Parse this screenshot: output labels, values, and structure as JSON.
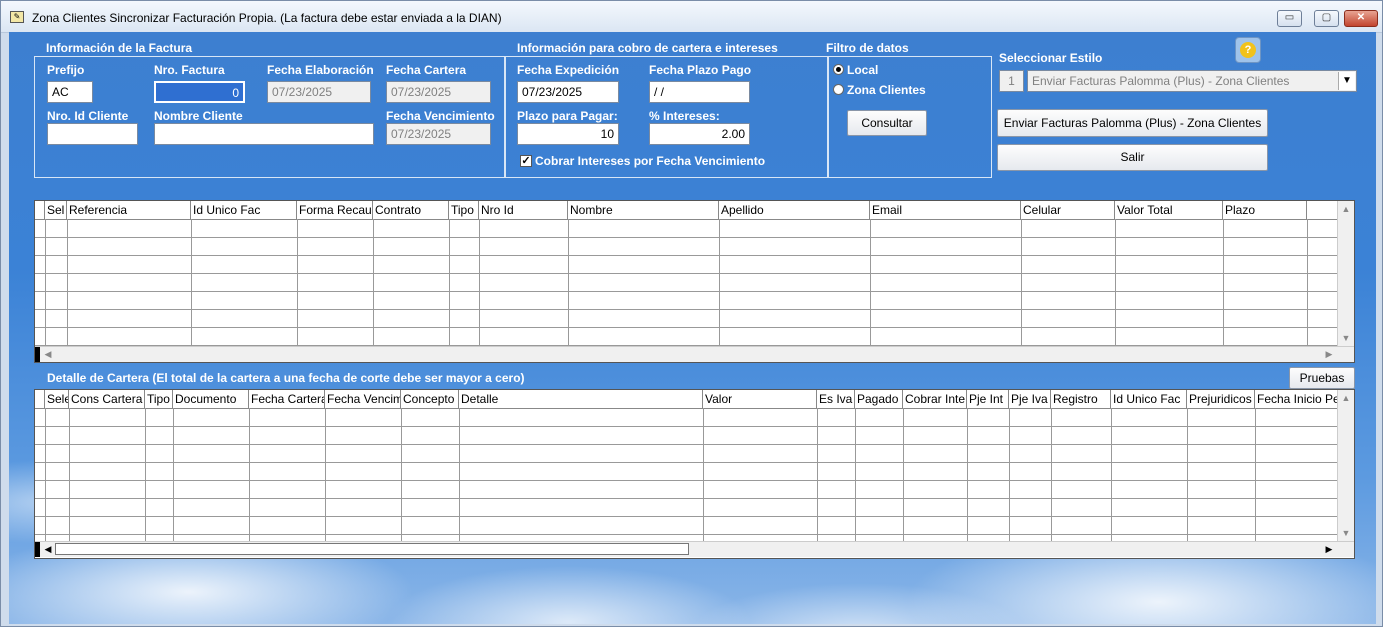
{
  "window": {
    "title": "Zona Clientes Sincronizar Facturación Propia. (La factura debe estar enviada a la DIAN)",
    "minimize_glyph": "▭",
    "maximize_glyph": "▢",
    "close_glyph": "✕"
  },
  "factura": {
    "section_title": "Información de la Factura",
    "prefijo_label": "Prefijo",
    "prefijo_value": "AC",
    "nro_factura_label": "Nro. Factura",
    "nro_factura_value": "0",
    "fecha_elaboracion_label": "Fecha Elaboración",
    "fecha_elaboracion_value": "07/23/2025",
    "fecha_cartera_label": "Fecha Cartera",
    "fecha_cartera_value": "07/23/2025",
    "nro_id_cliente_label": "Nro. Id Cliente",
    "nro_id_cliente_value": "",
    "nombre_cliente_label": "Nombre Cliente",
    "nombre_cliente_value": "",
    "fecha_vencimiento_label": "Fecha Vencimiento",
    "fecha_vencimiento_value": "07/23/2025"
  },
  "cobro": {
    "section_title": "Información para cobro de cartera e intereses",
    "fecha_expedicion_label": "Fecha Expedición",
    "fecha_expedicion_value": "07/23/2025",
    "fecha_plazo_label": "Fecha Plazo Pago",
    "fecha_plazo_value": " / /",
    "plazo_label": "Plazo para Pagar:",
    "plazo_value": "10",
    "intereses_label": "% Intereses:",
    "intereses_value": "2.00",
    "cobrar_label": "Cobrar Intereses por Fecha Vencimiento",
    "cobrar_checked": true
  },
  "filtro": {
    "section_title": "Filtro de datos",
    "local_label": "Local",
    "zona_label": "Zona Clientes",
    "selected": "Local",
    "consultar_label": "Consultar"
  },
  "estilo": {
    "label": "Seleccionar Estilo",
    "number": "1",
    "selected_value": "Enviar Facturas Palomma (Plus) - Zona Clientes",
    "enviar_label": "Enviar Facturas Palomma (Plus) - Zona Clientes",
    "salir_label": "Salir",
    "help_glyph": "?"
  },
  "grid1": {
    "columns": [
      "Sel",
      "Referencia",
      "Id Unico Fac",
      "Forma Recau",
      "Contrato",
      "Tipo",
      "Nro Id",
      "Nombre",
      "Apellido",
      "Email",
      "Celular",
      "Valor Total",
      "Plazo"
    ]
  },
  "cartera": {
    "section_title": "Detalle de Cartera (El total de la cartera a una fecha de corte debe ser mayor a cero)",
    "pruebas_label": "Pruebas",
    "columns": [
      "Sele",
      "Cons Cartera",
      "Tipo",
      "Documento",
      "Fecha Cartera",
      "Fecha Vencim",
      "Concepto",
      "Detalle",
      "Valor",
      "Es Iva",
      "Pagado",
      "Cobrar Inte",
      "Pje Int",
      "Pje Iva",
      "Registro",
      "Id Unico Fac",
      "Prejuridicos",
      "Fecha Inicio Pe"
    ]
  }
}
